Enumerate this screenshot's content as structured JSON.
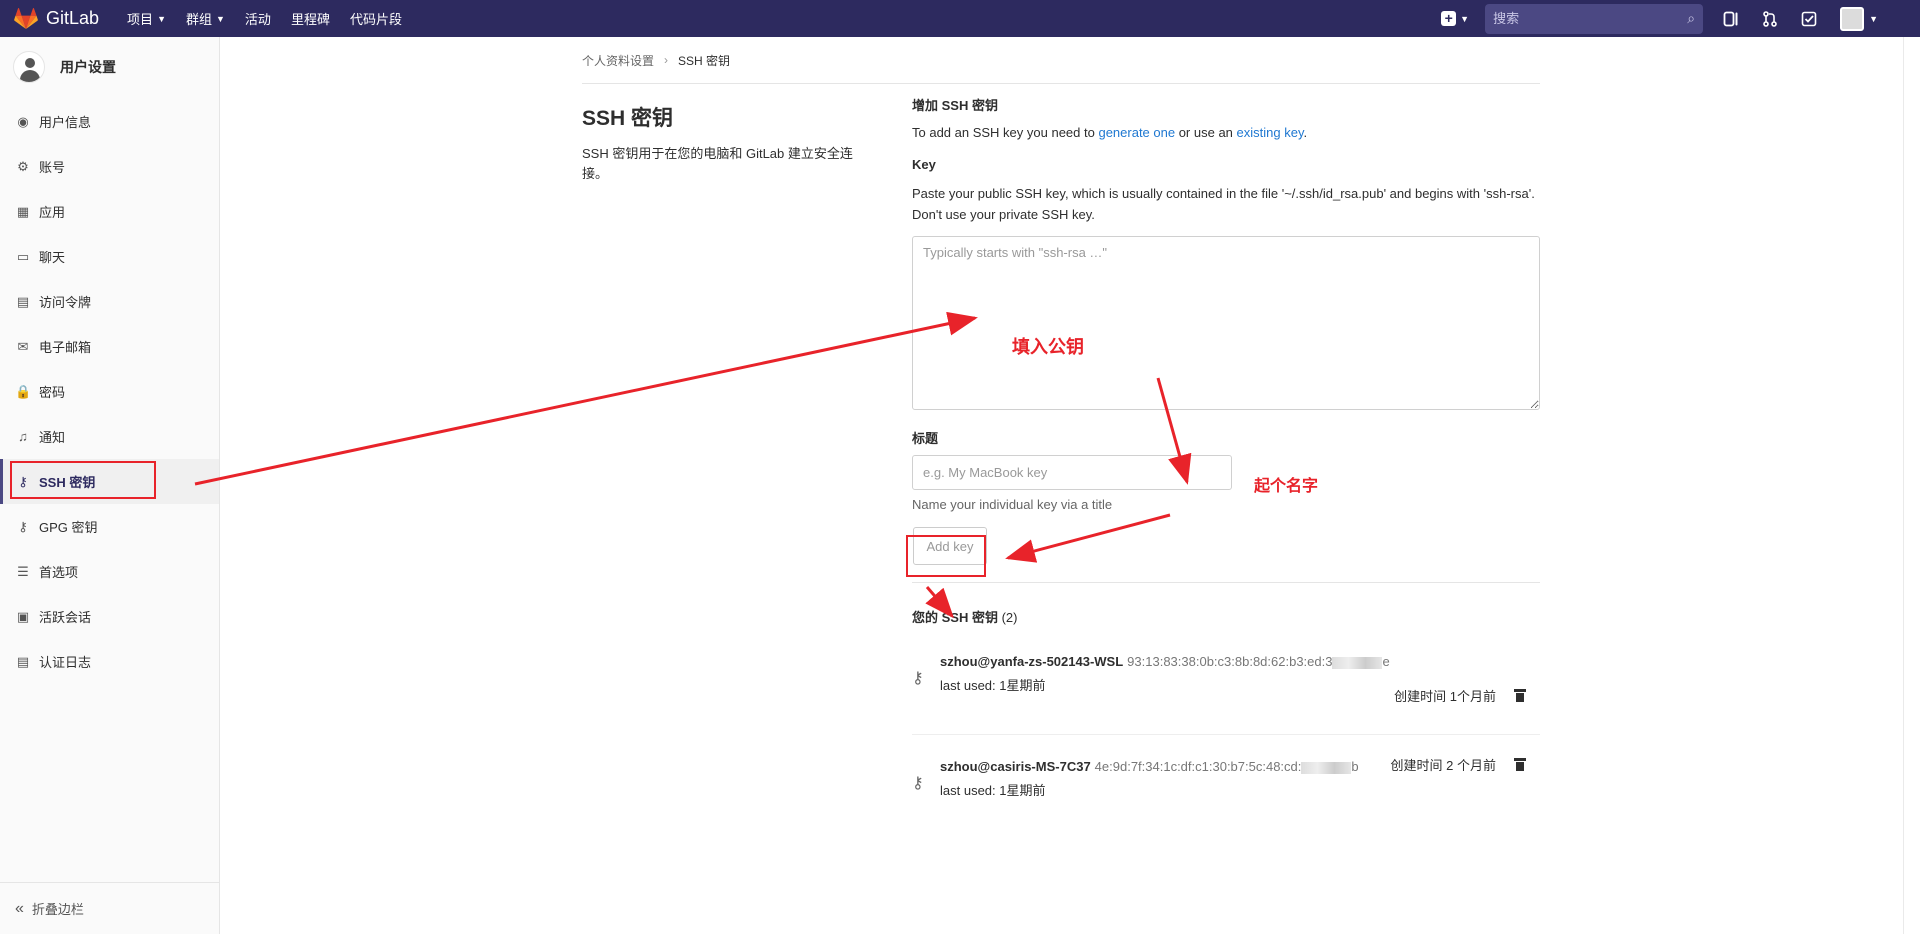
{
  "navbar": {
    "brand": "GitLab",
    "links": [
      {
        "label": "项目",
        "has_caret": true
      },
      {
        "label": "群组",
        "has_caret": true
      },
      {
        "label": "活动",
        "has_caret": false
      },
      {
        "label": "里程碑",
        "has_caret": false
      },
      {
        "label": "代码片段",
        "has_caret": false
      }
    ],
    "search_placeholder": "搜索",
    "icons": [
      "plus-icon",
      "search-icon",
      "issues-icon",
      "merge-request-icon",
      "todo-icon",
      "avatar"
    ],
    "accent_color": "#2d2a5f"
  },
  "sidebar": {
    "title": "用户设置",
    "items": [
      {
        "label": "用户信息",
        "icon": "profile-icon",
        "active": false
      },
      {
        "label": "账号",
        "icon": "account-icon",
        "active": false
      },
      {
        "label": "应用",
        "icon": "applications-icon",
        "active": false
      },
      {
        "label": "聊天",
        "icon": "chat-icon",
        "active": false
      },
      {
        "label": "访问令牌",
        "icon": "token-icon",
        "active": false
      },
      {
        "label": "电子邮箱",
        "icon": "email-icon",
        "active": false
      },
      {
        "label": "密码",
        "icon": "lock-icon",
        "active": false
      },
      {
        "label": "通知",
        "icon": "bell-icon",
        "active": false
      },
      {
        "label": "SSH 密钥",
        "icon": "key-icon",
        "active": true
      },
      {
        "label": "GPG 密钥",
        "icon": "key-icon",
        "active": false
      },
      {
        "label": "首选项",
        "icon": "preferences-icon",
        "active": false
      },
      {
        "label": "活跃会话",
        "icon": "monitor-icon",
        "active": false
      },
      {
        "label": "认证日志",
        "icon": "log-icon",
        "active": false
      }
    ],
    "collapse_label": "折叠边栏"
  },
  "breadcrumb": {
    "parent": "个人资料设置",
    "separator": "›",
    "current": "SSH 密钥"
  },
  "intro": {
    "title": "SSH 密钥",
    "description": "SSH 密钥用于在您的电脑和 GitLab 建立安全连接。"
  },
  "form": {
    "heading": "增加 SSH 密钥",
    "intro_prefix": "To add an SSH key you need to ",
    "generate_link": "generate one",
    "intro_middle": " or use an ",
    "existing_link": "existing key",
    "intro_suffix": ".",
    "key_label": "Key",
    "key_help": "Paste your public SSH key, which is usually contained in the file '~/.ssh/id_rsa.pub' and begins with 'ssh-rsa'. Don't use your private SSH key.",
    "key_placeholder": "Typically starts with \"ssh-rsa …\"",
    "title_label": "标题",
    "title_placeholder": "e.g. My MacBook key",
    "title_hint": "Name your individual key via a title",
    "add_button": "Add key"
  },
  "keys": {
    "heading": "您的 SSH 密钥",
    "count": "(2)",
    "items": [
      {
        "name": "szhou@yanfa-zs-502143-WSL",
        "fingerprint": "93:13:83:38:0b:c3:8b:8d:62:b3:ed:3",
        "fingerprint_end": "e",
        "last_used": "last used: 1星期前",
        "created": "创建时间 1个月前"
      },
      {
        "name": "szhou@casiris-MS-7C37",
        "fingerprint": "4e:9d:7f:34:1c:df:c1:30:b7:5c:48:cd:",
        "fingerprint_end": "b",
        "last_used": "last used: 1星期前",
        "created": "创建时间 2 个月前"
      }
    ]
  },
  "annotations": {
    "fill_key": "填入公钥",
    "name_it": "起个名字",
    "color": "#e8232a"
  }
}
